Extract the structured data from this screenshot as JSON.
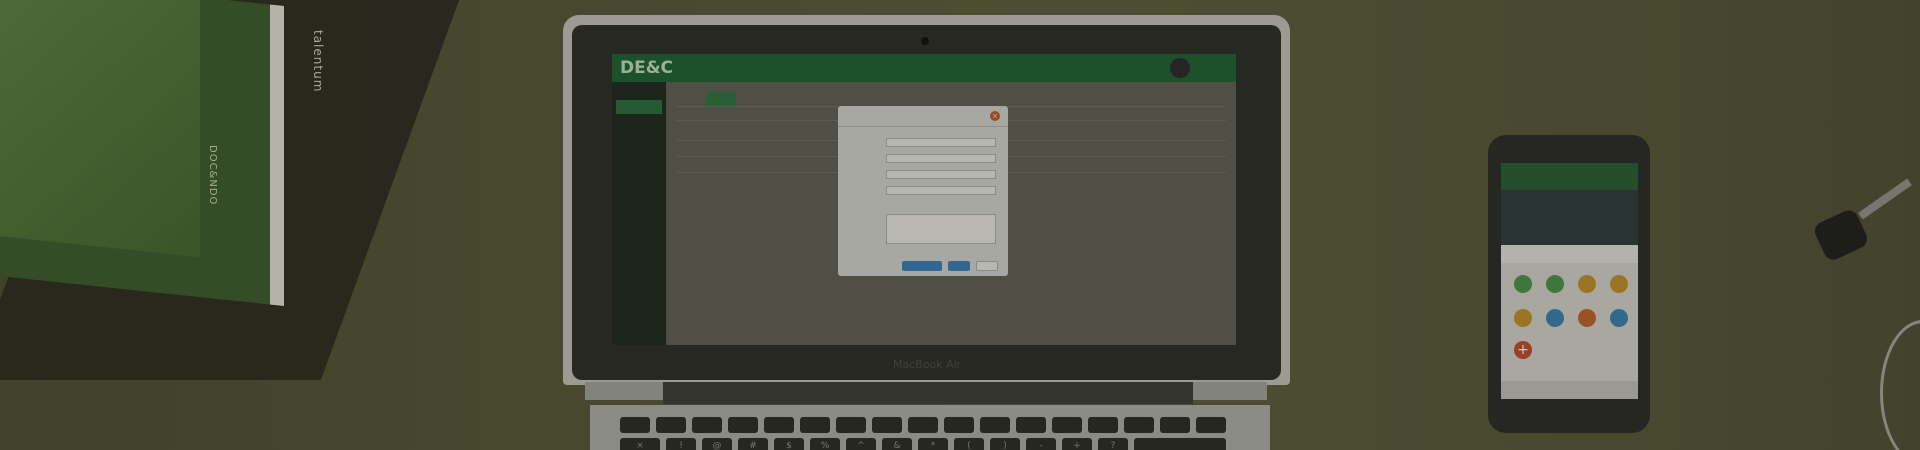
{
  "books": {
    "book_label": "talentum",
    "spine_label": "DOC&NDO"
  },
  "laptop": {
    "brand": "MacBook Air",
    "app_logo": "DE&C",
    "dialog_button_1": "",
    "dialog_button_2": "",
    "dialog_button_3": ""
  },
  "keyboard": {
    "keys": [
      "×",
      "!",
      "@",
      "#",
      "$",
      "%",
      "^",
      "&",
      "*",
      "(",
      ")",
      "-",
      "+",
      "?"
    ]
  },
  "phone": {},
  "colors": {
    "accent_green": "#1f5e35",
    "close_orange": "#b2582c",
    "dialog_blue": "#3b78b0"
  }
}
